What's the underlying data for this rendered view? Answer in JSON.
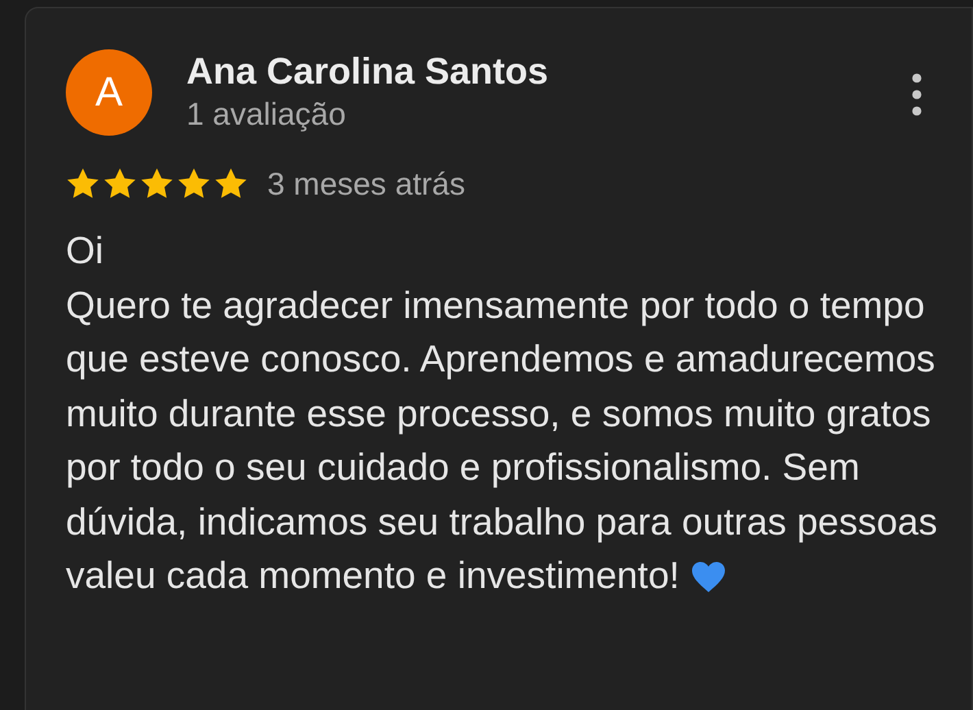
{
  "review": {
    "avatar_letter": "A",
    "author": "Ana Carolina Santos",
    "author_meta": "1 avaliação",
    "stars": 5,
    "time": "3 meses atrás",
    "text": "Oi\nQuero te agradecer imensamente por todo o tempo que esteve conosco. Aprendemos e amadurecemos muito durante esse processo, e somos muito gratos por todo o seu cuidado e profissionalismo. Sem dúvida, indicamos seu trabalho para outras pessoas valeu cada momento e investimento!"
  }
}
